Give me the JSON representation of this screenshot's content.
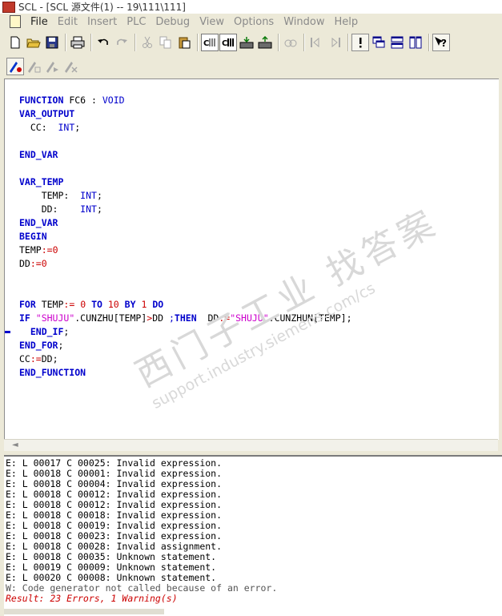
{
  "window": {
    "title": "SCL  - [SCL 源文件(1) -- 19\\111\\111]"
  },
  "menu": {
    "items": [
      {
        "label": "File",
        "active": true
      },
      {
        "label": "Edit",
        "active": false
      },
      {
        "label": "Insert",
        "active": false
      },
      {
        "label": "PLC",
        "active": false
      },
      {
        "label": "Debug",
        "active": false
      },
      {
        "label": "View",
        "active": false
      },
      {
        "label": "Options",
        "active": false
      },
      {
        "label": "Window",
        "active": false
      },
      {
        "label": "Help",
        "active": false
      }
    ]
  },
  "toolbar": {
    "row1": [
      "new-icon",
      "open-icon",
      "save-icon",
      "print-icon",
      "undo-icon",
      "redo-icon",
      "cut-icon",
      "copy-icon",
      "paste-icon",
      "compile-icon",
      "compile-all-icon",
      "download-icon",
      "upload-icon",
      "monitor-icon",
      "breakpoint-first-icon",
      "breakpoint-next-icon",
      "error-icon",
      "cascade-icon",
      "tile-horizontal-icon",
      "tile-vertical-icon",
      "help-icon"
    ],
    "row2": [
      "bp-set-icon",
      "bp-edit-icon",
      "bp-go-icon",
      "bp-delete-icon"
    ]
  },
  "editor": {
    "code": [
      [
        {
          "t": "FUNCTION ",
          "c": "kw"
        },
        {
          "t": "FC6 : "
        },
        {
          "t": "VOID",
          "c": "ty"
        }
      ],
      [
        {
          "t": "VAR_OUTPUT",
          "c": "kw"
        }
      ],
      [
        {
          "t": "  CC:  "
        },
        {
          "t": "INT",
          "c": "ty"
        },
        {
          "t": ";"
        }
      ],
      [],
      [
        {
          "t": "END_VAR",
          "c": "kw"
        }
      ],
      [],
      [
        {
          "t": "VAR_TEMP",
          "c": "kw"
        }
      ],
      [
        {
          "t": "    TEMP:  "
        },
        {
          "t": "INT",
          "c": "ty"
        },
        {
          "t": ";"
        }
      ],
      [
        {
          "t": "    DD:    "
        },
        {
          "t": "INT",
          "c": "ty"
        },
        {
          "t": ";"
        }
      ],
      [
        {
          "t": "END_VAR",
          "c": "kw"
        }
      ],
      [
        {
          "t": "BEGIN",
          "c": "kw"
        }
      ],
      [
        {
          "t": "TEMP"
        },
        {
          "t": ":=",
          "c": "op"
        },
        {
          "t": "0",
          "c": "num"
        }
      ],
      [
        {
          "t": "DD"
        },
        {
          "t": ":=",
          "c": "op"
        },
        {
          "t": "0",
          "c": "num"
        }
      ],
      [],
      [],
      [
        {
          "t": "FOR ",
          "c": "kw"
        },
        {
          "t": "TEMP"
        },
        {
          "t": ":=",
          "c": "op"
        },
        {
          "t": " "
        },
        {
          "t": "0",
          "c": "num"
        },
        {
          "t": " "
        },
        {
          "t": "TO",
          "c": "kw"
        },
        {
          "t": " "
        },
        {
          "t": "10",
          "c": "num"
        },
        {
          "t": " "
        },
        {
          "t": "BY",
          "c": "kw"
        },
        {
          "t": " "
        },
        {
          "t": "1",
          "c": "num"
        },
        {
          "t": " "
        },
        {
          "t": "DO",
          "c": "kw"
        }
      ],
      [
        {
          "t": "IF ",
          "c": "kw"
        },
        {
          "t": "\"SHUJU\"",
          "c": "str"
        },
        {
          "t": ".CUNZHU[TEMP]"
        },
        {
          "t": ">",
          "c": "op"
        },
        {
          "t": "DD "
        },
        {
          "t": ";",
          "c": "ty"
        },
        {
          "t": "THEN",
          "c": "kw"
        },
        {
          "t": "  DD"
        },
        {
          "t": ":=",
          "c": "op"
        },
        {
          "t": "\"SHUJU\"",
          "c": "str"
        },
        {
          "t": ".CUNZHUN[TEMP];"
        }
      ],
      [
        {
          "t": "  "
        },
        {
          "t": "END_IF",
          "c": "kw"
        },
        {
          "t": ";"
        }
      ],
      [
        {
          "t": "END_FOR",
          "c": "kw"
        },
        {
          "t": ";"
        }
      ],
      [
        {
          "t": "CC"
        },
        {
          "t": ":=",
          "c": "op"
        },
        {
          "t": "DD;"
        }
      ],
      [
        {
          "t": "END_FUNCTION",
          "c": "kw"
        }
      ]
    ]
  },
  "watermark": {
    "line1": "西门子工业  找答案",
    "line2": "support.industry.siemens.com/cs"
  },
  "output": {
    "lines": [
      {
        "text": "E: L 00017 C 00025: Invalid expression."
      },
      {
        "text": "E: L 00018 C 00001: Invalid expression."
      },
      {
        "text": "E: L 00018 C 00004: Invalid expression."
      },
      {
        "text": "E: L 00018 C 00012: Invalid expression."
      },
      {
        "text": "E: L 00018 C 00012: Invalid expression."
      },
      {
        "text": "E: L 00018 C 00018: Invalid expression."
      },
      {
        "text": "E: L 00018 C 00019: Invalid expression."
      },
      {
        "text": "E: L 00018 C 00023: Invalid expression."
      },
      {
        "text": "E: L 00018 C 00028: Invalid assignment."
      },
      {
        "text": "E: L 00018 C 00035: Unknown statement."
      },
      {
        "text": "E: L 00019 C 00009: Unknown statement."
      },
      {
        "text": "E: L 00020 C 00008: Unknown statement."
      },
      {
        "text": "W: Code generator not called because of an error.",
        "kind": "warn"
      },
      {
        "text": "Result: 23 Errors, 1 Warning(s)",
        "kind": "result"
      }
    ]
  }
}
